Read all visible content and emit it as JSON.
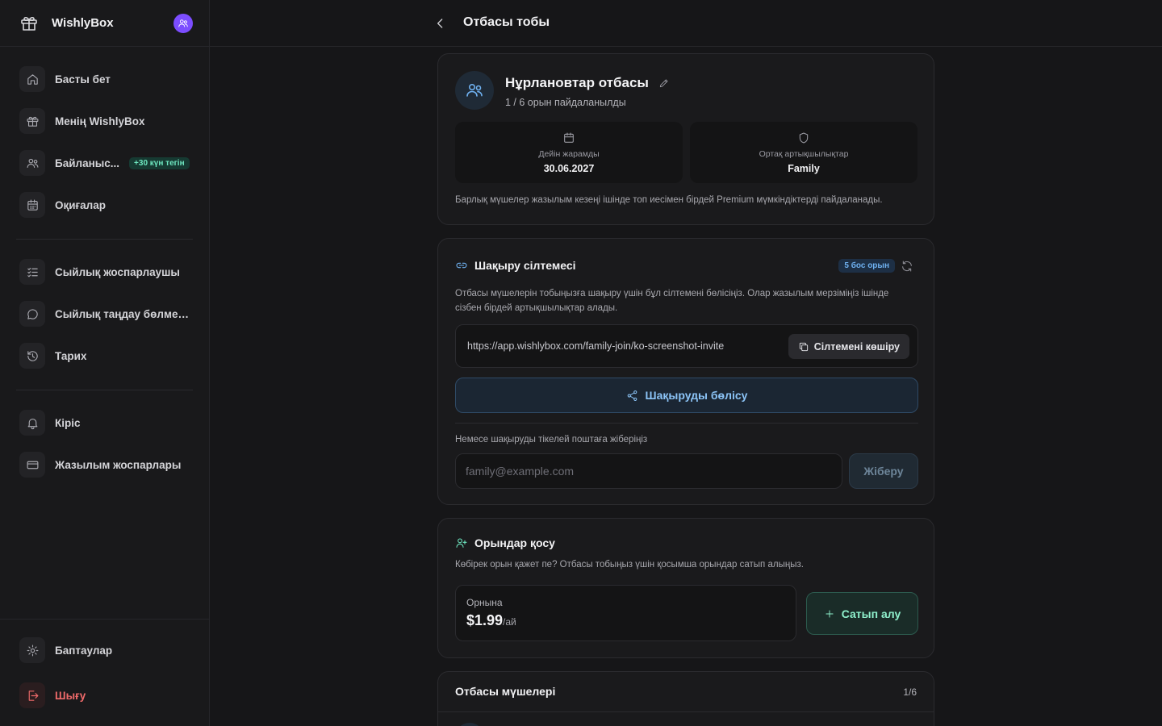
{
  "sidebar": {
    "brand": "WishlyBox",
    "nav_primary": [
      {
        "label": "Басты бет",
        "icon": "home-icon"
      },
      {
        "label": "Менің WishlyBox",
        "icon": "gift-icon"
      },
      {
        "label": "Байланыс...",
        "icon": "users-icon",
        "badge": "+30 күн тегін"
      },
      {
        "label": "Оқиғалар",
        "icon": "calendar-icon"
      }
    ],
    "nav_secondary": [
      {
        "label": "Сыйлық жоспарлаушы",
        "icon": "checklist-icon"
      },
      {
        "label": "Сыйлық таңдау бөлмел...",
        "icon": "chat-icon"
      },
      {
        "label": "Тарих",
        "icon": "history-icon"
      }
    ],
    "nav_tertiary": [
      {
        "label": "Кіріс",
        "icon": "bell-icon"
      },
      {
        "label": "Жазылым жоспарлары",
        "icon": "credit-card-icon"
      }
    ],
    "footer": {
      "settings": "Баптаулар",
      "logout": "Шығу"
    }
  },
  "topbar": {
    "title": "Отбасы тобы"
  },
  "family": {
    "name": "Нұрлановтар отбасы",
    "usage": "1 / 6 орын пайдаланылды",
    "valid_until_label": "Дейін жарамды",
    "valid_until_value": "30.06.2027",
    "benefits_label": "Ортақ артықшылықтар",
    "benefits_value": "Family",
    "note": "Барлық мүшелер жазылым кезеңі ішінде топ иесімен бірдей Premium мүмкіндіктерді пайдаланады."
  },
  "invite": {
    "title": "Шақыру сілтемесі",
    "free_seats_badge": "5 бос орын",
    "description": "Отбасы мүшелерін тобыңызға шақыру үшін бұл сілтемені бөлісіңіз. Олар жазылым мерзіміңіз ішінде сізбен бірдей артықшылықтар алады.",
    "link": "https://app.wishlybox.com/family-join/ko-screenshot-invite",
    "copy_label": "Сілтемені көшіру",
    "share_label": "Шақыруды бөлісу",
    "email_label": "Немесе шақыруды тікелей поштаға жіберіңіз",
    "email_placeholder": "family@example.com",
    "send_label": "Жіберу"
  },
  "seats": {
    "title": "Орындар қосу",
    "description": "Көбірек орын қажет пе? Отбасы тобыңыз үшін қосымша орындар сатып алыңыз.",
    "price_label": "Орнына",
    "price_value": "$1.99",
    "price_unit": "/ай",
    "buy_label": "Сатып алу"
  },
  "members": {
    "title": "Отбасы мүшелері",
    "count": "1/6"
  },
  "colors": {
    "accent_blue": "#6fb1f0",
    "accent_green": "#6ee7c0",
    "danger": "#ef6a6a",
    "avatar_purple": "#7c4dff"
  }
}
